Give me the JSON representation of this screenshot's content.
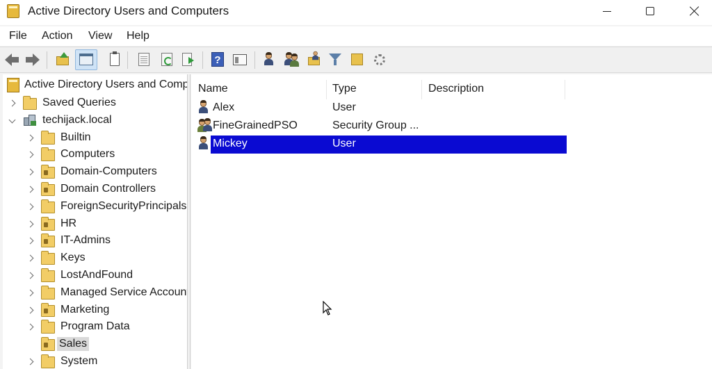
{
  "window": {
    "title": "Active Directory Users and Computers"
  },
  "menu": [
    "File",
    "Action",
    "View",
    "Help"
  ],
  "toolbar": {
    "icons": [
      "back-arrow-icon",
      "forward-arrow-icon",
      "up-folder-icon",
      "show-hide-console-tree-icon",
      "clipboard-icon",
      "properties-icon",
      "refresh-icon",
      "export-list-icon",
      "help-icon",
      "console-icon",
      "create-user-icon",
      "create-group-icon",
      "create-ou-icon",
      "filter-icon",
      "find-icon",
      "delegate-control-icon"
    ]
  },
  "tree": {
    "root": "Active Directory Users and Computers",
    "items": [
      {
        "label": "Saved Queries",
        "level": 1,
        "expand": "right",
        "icon": "folder"
      },
      {
        "label": "techijack.local",
        "level": 1,
        "expand": "down",
        "icon": "domain"
      },
      {
        "label": "Builtin",
        "level": 2,
        "expand": "right",
        "icon": "folder"
      },
      {
        "label": "Computers",
        "level": 2,
        "expand": "right",
        "icon": "folder"
      },
      {
        "label": "Domain-Computers",
        "level": 2,
        "expand": "right",
        "icon": "ou"
      },
      {
        "label": "Domain Controllers",
        "level": 2,
        "expand": "right",
        "icon": "ou"
      },
      {
        "label": "ForeignSecurityPrincipals",
        "level": 2,
        "expand": "right",
        "icon": "folder"
      },
      {
        "label": "HR",
        "level": 2,
        "expand": "right",
        "icon": "ou"
      },
      {
        "label": "IT-Admins",
        "level": 2,
        "expand": "right",
        "icon": "ou"
      },
      {
        "label": "Keys",
        "level": 2,
        "expand": "right",
        "icon": "folder"
      },
      {
        "label": "LostAndFound",
        "level": 2,
        "expand": "right",
        "icon": "folder"
      },
      {
        "label": "Managed Service Accounts",
        "level": 2,
        "expand": "right",
        "icon": "folder"
      },
      {
        "label": "Marketing",
        "level": 2,
        "expand": "right",
        "icon": "ou"
      },
      {
        "label": "Program Data",
        "level": 2,
        "expand": "right",
        "icon": "folder"
      },
      {
        "label": "Sales",
        "level": 2,
        "expand": "none",
        "icon": "ou",
        "selected": true
      },
      {
        "label": "System",
        "level": 2,
        "expand": "right",
        "icon": "folder"
      }
    ]
  },
  "list": {
    "columns": [
      "Name",
      "Type",
      "Description"
    ],
    "rows": [
      {
        "name": "Alex",
        "type": "User",
        "description": "",
        "icon": "user"
      },
      {
        "name": "FineGrainedPSO",
        "type": "Security Group ...",
        "description": "",
        "icon": "group"
      },
      {
        "name": "Mickey",
        "type": "User",
        "description": "",
        "icon": "user",
        "selected": true
      }
    ]
  },
  "colors": {
    "selection": "#0a0ad2",
    "tree_selection": "#d9d9d9",
    "folder": "#f2cd66"
  }
}
